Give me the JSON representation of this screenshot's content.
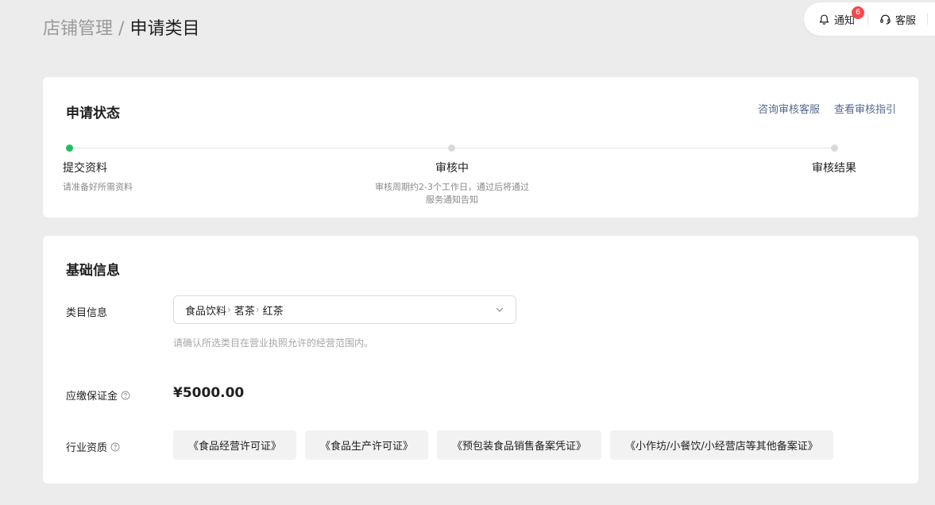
{
  "breadcrumb": {
    "parent": "店铺管理",
    "separator": "/",
    "current": "申请类目"
  },
  "toolbar": {
    "notify_label": "通知",
    "notify_count": "6",
    "service_label": "客服"
  },
  "status_card": {
    "title": "申请状态",
    "links": [
      "咨询审核客服",
      "查看审核指引"
    ],
    "steps": [
      {
        "label": "提交资料",
        "desc": "请准备好所需资料",
        "active": true
      },
      {
        "label": "审核中",
        "desc": "审核周期约2-3个工作日，通过后将通过服务通知告知",
        "active": false
      },
      {
        "label": "审核结果",
        "desc": "",
        "active": false
      }
    ]
  },
  "basic_card": {
    "title": "基础信息",
    "category": {
      "label": "类目信息",
      "path": [
        "食品饮料",
        "茗茶",
        "红茶"
      ],
      "hint": "请确认所选类目在营业执照允许的经营范围内。"
    },
    "deposit": {
      "label": "应缴保证金",
      "amount": "¥5000.00"
    },
    "qualification": {
      "label": "行业资质",
      "items": [
        "《食品经营许可证》",
        "《食品生产许可证》",
        "《预包装食品销售备案凭证》",
        "《小作坊/小餐饮/小经营店等其他备案证》"
      ]
    }
  },
  "colors": {
    "active_step": "#1fbf5f",
    "link": "#55698f",
    "badge": "#f5484a",
    "background": "#ececec"
  }
}
